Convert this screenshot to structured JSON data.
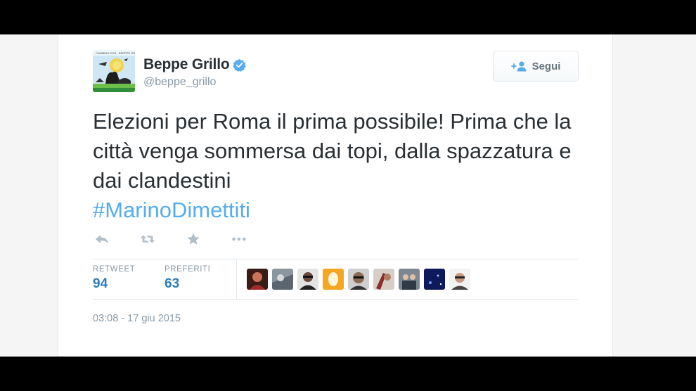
{
  "tweet": {
    "display_name": "Beppe Grillo",
    "handle": "@beppe_grillo",
    "verified_icon": "verified-badge-icon",
    "text": "Elezioni per Roma il prima possibile! Prima che la città venga sommersa dai topi, dalla spazzatura e dai clandestini",
    "hashtag": "#MarinoDimettiti",
    "timestamp": "03:08 - 17 giu 2015"
  },
  "follow_button": {
    "label": "Segui",
    "icon": "add-user-icon"
  },
  "actions": [
    {
      "name": "reply-icon"
    },
    {
      "name": "retweet-icon"
    },
    {
      "name": "favorite-star-icon"
    },
    {
      "name": "more-options-icon"
    }
  ],
  "stats": {
    "retweet_label": "RETWEET",
    "retweet_count": "94",
    "favorites_label": "PREFERITI",
    "favorites_count": "63"
  },
  "colors": {
    "link": "#55acee",
    "stat_value": "#2b7bb9",
    "text": "#292f33",
    "muted": "#8899a6"
  },
  "favoriter_avatars": 9
}
